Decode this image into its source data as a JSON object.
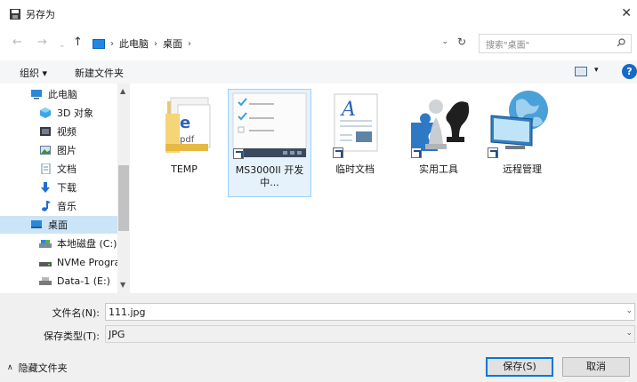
{
  "window": {
    "title": "另存为"
  },
  "address": {
    "breadcrumbs": [
      "此电脑",
      "桌面"
    ],
    "search_placeholder": "搜索\"桌面\""
  },
  "toolbar": {
    "organize": "组织 ▾",
    "new_folder": "新建文件夹",
    "help": "?"
  },
  "nav": {
    "items": [
      {
        "label": "此电脑",
        "icon": "computer-icon"
      },
      {
        "label": "3D 对象",
        "icon": "3d-objects-icon"
      },
      {
        "label": "视频",
        "icon": "video-icon"
      },
      {
        "label": "图片",
        "icon": "pictures-icon"
      },
      {
        "label": "文档",
        "icon": "documents-icon"
      },
      {
        "label": "下载",
        "icon": "download-icon"
      },
      {
        "label": "音乐",
        "icon": "music-icon"
      },
      {
        "label": "桌面",
        "icon": "desktop-icon"
      },
      {
        "label": "本地磁盘 (C:)",
        "icon": "drive-icon"
      },
      {
        "label": "NVMe Progra",
        "icon": "drive-icon"
      },
      {
        "label": "Data-1 (E:)",
        "icon": "drive-icon"
      }
    ],
    "selected": "桌面"
  },
  "files": [
    {
      "name": "TEMP",
      "icon": "folder-icon"
    },
    {
      "name": "MS3000II 开发中...",
      "icon": "app-shortcut-icon"
    },
    {
      "name": "临时文档",
      "icon": "document-shortcut-icon"
    },
    {
      "name": "实用工具",
      "icon": "tools-shortcut-icon"
    },
    {
      "name": "远程管理",
      "icon": "remote-shortcut-icon"
    }
  ],
  "form": {
    "filename_label": "文件名(N):",
    "filename_value": "111.jpg",
    "filetype_label": "保存类型(T):",
    "filetype_value": "JPG"
  },
  "footer": {
    "hide_folders": "隐藏文件夹",
    "save": "保存(S)",
    "cancel": "取消"
  },
  "colors": {
    "accent": "#0078d7",
    "selection": "#cce4f7"
  }
}
